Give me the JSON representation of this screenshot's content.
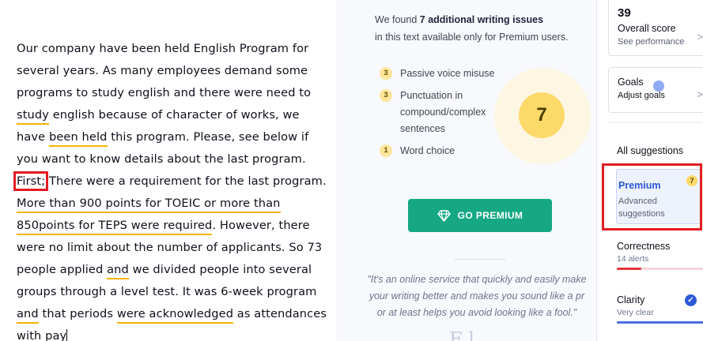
{
  "editor": {
    "lines": [
      [
        {
          "t": "Our company have been held English Program for"
        }
      ],
      [
        {
          "t": "several years. As many employees demand some"
        }
      ],
      [
        {
          "t": "programs to study english and there were need to"
        }
      ],
      [
        {
          "t": "study",
          "u": true
        },
        {
          "t": " english because of character of works, we"
        }
      ],
      [
        {
          "t": "have "
        },
        {
          "t": "been held",
          "u": true
        },
        {
          "t": " this program. Please, see below if"
        }
      ],
      [
        {
          "t": "you want to know details about the last program."
        }
      ],
      [
        {
          "t": "First;",
          "box": true
        },
        {
          "t": " There were a requirement for the last program."
        }
      ],
      [
        {
          "t": "More than 900 points for TOEIC or more than",
          "u": true
        }
      ],
      [
        {
          "t": "850points for TEPS were required",
          "u": true
        },
        {
          "t": ". However, there"
        }
      ],
      [
        {
          "t": "were no limit about the number of applicants. So 73"
        }
      ],
      [
        {
          "t": "people applied "
        },
        {
          "t": "and",
          "u": true
        },
        {
          "t": " we divided people into several"
        }
      ],
      [
        {
          "t": "groups through a level test. It was 6-week program"
        }
      ],
      [
        {
          "t": "and",
          "u": true
        },
        {
          "t": " that periods "
        },
        {
          "t": "were acknowledged",
          "u": true
        },
        {
          "t": " as attendances"
        }
      ],
      [
        {
          "t": "with pay",
          "cursor": true
        }
      ]
    ]
  },
  "premium_panel": {
    "found_prefix": "We found ",
    "found_bold": "7 additional writing issues",
    "found_suffix": "in this text available only for Premium users.",
    "issues": [
      {
        "count": "3",
        "label": "Passive voice misuse"
      },
      {
        "count": "3",
        "label": "Punctuation in compound/complex sentences"
      },
      {
        "count": "1",
        "label": "Word choice"
      }
    ],
    "total": "7",
    "go_premium_label": "GO PREMIUM",
    "go_premium_icon": "diamond-icon",
    "quote": [
      "\"It's an online service that quickly and easily make",
      "your writing better and makes you sound like a pr",
      "or at least helps you avoid looking like a fool.\""
    ],
    "quote_source_partial": "F  l"
  },
  "sidebar": {
    "score_value": "39",
    "score_label": "Overall score",
    "score_link": "See performance",
    "goals_title": "Goals",
    "goals_link": "Adjust goals",
    "all_suggestions_label": "All suggestions",
    "premium": {
      "title": "Premium",
      "subtitle": "Advanced suggestions",
      "badge": "7"
    },
    "categories": [
      {
        "title": "Correctness",
        "subtitle": "14 alerts",
        "color": "#e5343a",
        "fill": 0.28
      },
      {
        "title": "Clarity",
        "subtitle": "Very clear",
        "color": "#4a6ee0",
        "fill": 1.0
      }
    ],
    "chevron": ">"
  }
}
